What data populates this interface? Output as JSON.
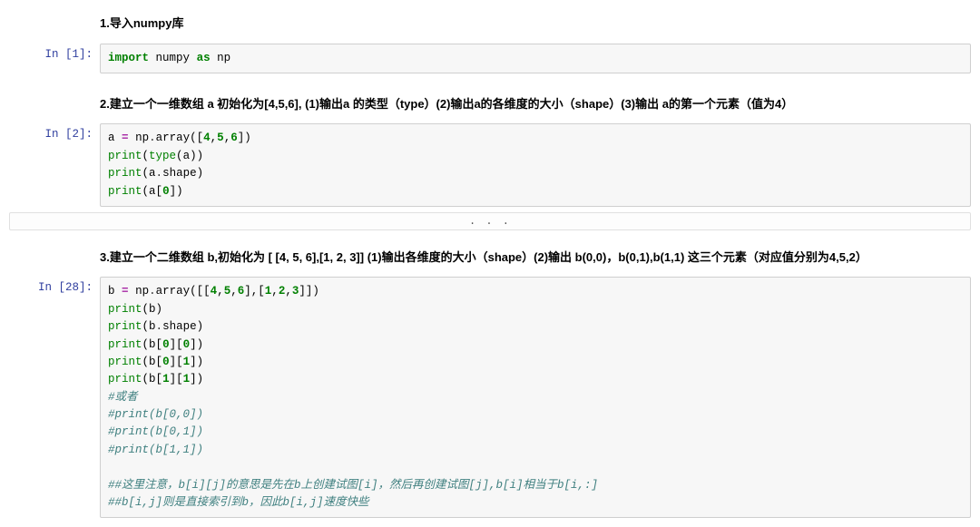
{
  "headings": {
    "h1": "1.导入numpy库",
    "h2": "2.建立一个一维数组 a 初始化为[4,5,6], (1)输出a 的类型（type）(2)输出a的各维度的大小（shape）(3)输出 a的第一个元素（值为4）",
    "h3": "3.建立一个二维数组 b,初始化为 [ [4, 5, 6],[1, 2, 3]] (1)输出各维度的大小（shape）(2)输出 b(0,0)，b(0,1),b(1,1) 这三个元素（对应值分别为4,5,2）"
  },
  "cells": {
    "c1": {
      "prompt": "In [1]:",
      "code": {
        "import": "import",
        "numpy": "numpy",
        "as": "as",
        "np": "np"
      }
    },
    "c2": {
      "prompt": "In [2]:",
      "tokens": {
        "a": "a",
        "eq": "=",
        "np": "np",
        "array": "array",
        "lbrack": "[",
        "rbrack": "]",
        "n4": "4",
        "n5": "5",
        "n6": "6",
        "n0": "0",
        "print": "print",
        "type": "type",
        "shape": "shape",
        "comma": ",",
        "lpar": "(",
        "rpar": ")",
        "dot": "."
      }
    },
    "collapsed": ". . .",
    "c3": {
      "prompt": "In [28]:",
      "tokens": {
        "b": "b",
        "eq": "=",
        "np": "np",
        "array": "array",
        "n4": "4",
        "n5": "5",
        "n6": "6",
        "n1": "1",
        "n2": "2",
        "n3": "3",
        "n0": "0",
        "print": "print",
        "shape": "shape",
        "dot": ".",
        "lpar": "(",
        "rpar": ")",
        "lbrack": "[",
        "rbrack": "]",
        "comma": ","
      },
      "comments": {
        "or": "#或者",
        "p00": "#print(b[0,0])",
        "p01": "#print(b[0,1])",
        "p11": "#print(b[1,1])",
        "note1": "##这里注意，b[i][j]的意思是先在b上创建试图[i]，然后再创建试图[j],b[i]相当于b[i,:]",
        "note2": "##b[i,j]则是直接索引到b，因此b[i,j]速度快些"
      }
    }
  }
}
